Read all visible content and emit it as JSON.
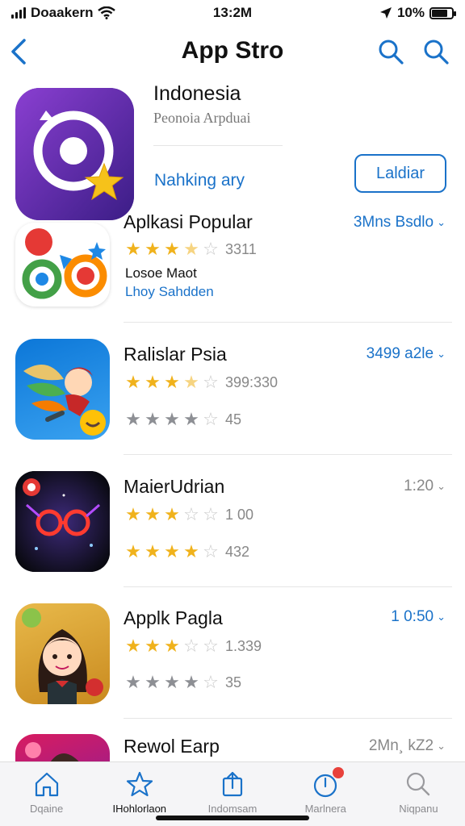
{
  "status": {
    "carrier": "Doaakern",
    "time": "13:2M",
    "battery": "10%",
    "battery_level": 0.8
  },
  "nav": {
    "title": "App Stro",
    "icons": [
      "chevron-left-icon",
      "search-icon",
      "search-icon"
    ]
  },
  "featured": {
    "name": "Indonesia",
    "subtitle": "Peonoia Arpduai",
    "ranking": "Nahking ary",
    "get_label": "Laldiar"
  },
  "apps": [
    {
      "name": "Aplkasi Popular",
      "meta": "3Mns Bsdlo",
      "rating_a": 3.5,
      "count_a": "3311",
      "line2a": "Losoe Maot",
      "line2b": "Lhoy Sahdden"
    },
    {
      "name": "Ralislar Psia",
      "meta": "3499 a2le",
      "rating_a": 3.5,
      "count_a": "399:330",
      "rating_b": 4,
      "count_b": "45"
    },
    {
      "name": "MaierUdrian",
      "meta": "1:20",
      "rating_a": 3,
      "count_a": "1 00",
      "rating_b": 4,
      "count_b": "432"
    },
    {
      "name": "Applk Pagla",
      "meta": "1 0:50",
      "rating_a": 3,
      "count_a": "1.339",
      "rating_b": 4,
      "count_b": "35"
    },
    {
      "name": "Rewol Earp",
      "meta": "2Mn¸ kZ2"
    }
  ],
  "tabs": [
    {
      "label": "Dqaine",
      "icon": "home-icon"
    },
    {
      "label": "IHohlorlaon",
      "icon": "star-icon"
    },
    {
      "label": "Indomsam",
      "icon": "share-icon"
    },
    {
      "label": "Marlnera",
      "icon": "updates-icon",
      "badge": true
    },
    {
      "label": "Niqpanu",
      "icon": "search-icon"
    }
  ],
  "colors": {
    "accent": "#1a72c9",
    "star_gold": "#f0b21c",
    "star_silver": "#8d8f94",
    "badge": "#e8413b"
  }
}
